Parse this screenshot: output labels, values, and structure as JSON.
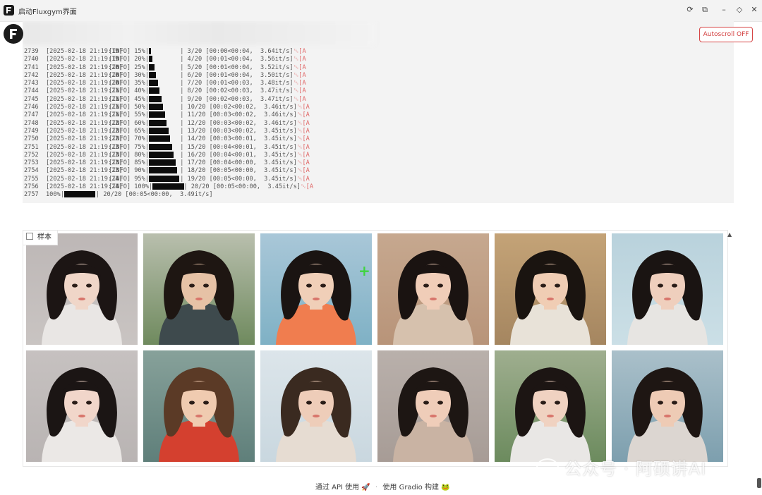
{
  "window": {
    "title": "启动Fluxgym界面",
    "controls": {
      "refresh": "⟳",
      "popout": "⧉",
      "minimize": "–",
      "restore": "◇",
      "close": "✕"
    }
  },
  "header": {
    "autoscroll_label": "Autoscroll OFF"
  },
  "log": {
    "lines": [
      {
        "num": "2739",
        "ts": "[2025-02-18 21:19:19]",
        "lvl": "[INFO] 15%|",
        "bar": 1,
        "prog": "| 3/20 [00:00<00:04,  3.64it/s]",
        "esc": "␛[A"
      },
      {
        "num": "2740",
        "ts": "[2025-02-18 21:19:19]",
        "lvl": "[INFO] 20%|",
        "bar": 2,
        "prog": "| 4/20 [00:01<00:04,  3.56it/s]",
        "esc": "␛[A"
      },
      {
        "num": "2741",
        "ts": "[2025-02-18 21:19:20]",
        "lvl": "[INFO] 25%|",
        "bar": 3,
        "prog": "| 5/20 [00:01<00:04,  3.52it/s]",
        "esc": "␛[A"
      },
      {
        "num": "2742",
        "ts": "[2025-02-18 21:19:20]",
        "lvl": "[INFO] 30%|",
        "bar": 4,
        "prog": "| 6/20 [00:01<00:04,  3.50it/s]",
        "esc": "␛[A"
      },
      {
        "num": "2743",
        "ts": "[2025-02-18 21:19:20]",
        "lvl": "[INFO] 35%|",
        "bar": 5,
        "prog": "| 7/20 [00:01<00:03,  3.48it/s]",
        "esc": "␛[A"
      },
      {
        "num": "2744",
        "ts": "[2025-02-18 21:19:21]",
        "lvl": "[INFO] 40%|",
        "bar": 6,
        "prog": "| 8/20 [00:02<00:03,  3.47it/s]",
        "esc": "␛[A"
      },
      {
        "num": "2745",
        "ts": "[2025-02-18 21:19:21]",
        "lvl": "[INFO] 45%|",
        "bar": 7,
        "prog": "| 9/20 [00:02<00:03,  3.47it/s]",
        "esc": "␛[A"
      },
      {
        "num": "2746",
        "ts": "[2025-02-18 21:19:21]",
        "lvl": "[INFO] 50%|",
        "bar": 8,
        "prog": "| 10/20 [00:02<00:02,  3.46it/s]",
        "esc": "␛[A"
      },
      {
        "num": "2747",
        "ts": "[2025-02-18 21:19:21]",
        "lvl": "[INFO] 55%|",
        "bar": 9,
        "prog": "| 11/20 [00:03<00:02,  3.46it/s]",
        "esc": "␛[A"
      },
      {
        "num": "2748",
        "ts": "[2025-02-18 21:19:22]",
        "lvl": "[INFO] 60%|",
        "bar": 10,
        "prog": "| 12/20 [00:03<00:02,  3.46it/s]",
        "esc": "␛[A"
      },
      {
        "num": "2749",
        "ts": "[2025-02-18 21:19:22]",
        "lvl": "[INFO] 65%|",
        "bar": 11,
        "prog": "| 13/20 [00:03<00:02,  3.45it/s]",
        "esc": "␛[A"
      },
      {
        "num": "2750",
        "ts": "[2025-02-18 21:19:22]",
        "lvl": "[INFO] 70%|",
        "bar": 12,
        "prog": "| 14/20 [00:03<00:01,  3.45it/s]",
        "esc": "␛[A"
      },
      {
        "num": "2751",
        "ts": "[2025-02-18 21:19:23]",
        "lvl": "[INFO] 75%|",
        "bar": 13,
        "prog": "| 15/20 [00:04<00:01,  3.45it/s]",
        "esc": "␛[A"
      },
      {
        "num": "2752",
        "ts": "[2025-02-18 21:19:23]",
        "lvl": "[INFO] 80%|",
        "bar": 14,
        "prog": "| 16/20 [00:04<00:01,  3.45it/s]",
        "esc": "␛[A"
      },
      {
        "num": "2753",
        "ts": "[2025-02-18 21:19:23]",
        "lvl": "[INFO] 85%|",
        "bar": 15,
        "prog": "| 17/20 [00:04<00:00,  3.45it/s]",
        "esc": "␛[A"
      },
      {
        "num": "2754",
        "ts": "[2025-02-18 21:19:23]",
        "lvl": "[INFO] 90%|",
        "bar": 16,
        "prog": "| 18/20 [00:05<00:00,  3.45it/s]",
        "esc": "␛[A"
      },
      {
        "num": "2755",
        "ts": "[2025-02-18 21:19:24]",
        "lvl": "[INFO] 95%|",
        "bar": 17,
        "prog": "| 19/20 [00:05<00:00,  3.45it/s]",
        "esc": "␛[A"
      },
      {
        "num": "2756",
        "ts": "[2025-02-18 21:19:24]",
        "lvl": "[INFO] 100%|",
        "bar": 18,
        "prog": "| 20/20 [00:05<00:00,  3.45it/s]",
        "esc": "␛[A"
      }
    ],
    "final_line": {
      "num": "2757",
      "pct": "100%|",
      "prog": "| 20/20 [00:05<00:00,  3.49it/s]"
    }
  },
  "gallery": {
    "label": "样本",
    "images": [
      {
        "bg": "#c9c4c2",
        "top": "#bdb7b6",
        "skin": "#f0d6c8",
        "hair": "#1c1514",
        "shirt": "#e9e6e4"
      },
      {
        "bg": "#6f8a5e",
        "top": "#b9bfae",
        "skin": "#e6c2a6",
        "hair": "#1e1612",
        "shirt": "#3e4a4d"
      },
      {
        "bg": "#7fb1c5",
        "top": "#a9c7d8",
        "skin": "#f0cfb8",
        "hair": "#1a1412",
        "shirt": "#f07d4f"
      },
      {
        "bg": "#b89479",
        "top": "#c6a88f",
        "skin": "#f0cdb8",
        "hair": "#1a1311",
        "shirt": "#d6c1ad"
      },
      {
        "bg": "#a58660",
        "top": "#c4a377",
        "skin": "#f0cdb4",
        "hair": "#1a1410",
        "shirt": "#e8e2d8"
      },
      {
        "bg": "#cbdfe6",
        "top": "#b9d2dc",
        "skin": "#efcfbd",
        "hair": "#1a1412",
        "shirt": "#e7e5e2"
      },
      {
        "bg": "#b9b4b3",
        "top": "#c6c1c0",
        "skin": "#f1d6ca",
        "hair": "#1b1514",
        "shirt": "#ebe8e6"
      },
      {
        "bg": "#5f7f7a",
        "top": "#87a19a",
        "skin": "#f0cbb0",
        "hair": "#5b3a26",
        "shirt": "#d4402f"
      },
      {
        "bg": "#c9d7df",
        "top": "#dce5ea",
        "skin": "#eecdb9",
        "hair": "#3a2a20",
        "shirt": "#e6dcd2"
      },
      {
        "bg": "#a79c96",
        "top": "#b9b0ab",
        "skin": "#efcdb9",
        "hair": "#1d1613",
        "shirt": "#c9b3a3"
      },
      {
        "bg": "#6c8b5e",
        "top": "#9fae8f",
        "skin": "#f0d2c1",
        "hair": "#1c1513",
        "shirt": "#e9e7e5"
      },
      {
        "bg": "#7d9fae",
        "top": "#aac0ca",
        "skin": "#eecbb5",
        "hair": "#1e1613",
        "shirt": "#dcd6d1"
      }
    ]
  },
  "footer": {
    "api_text": "通过 API 使用",
    "api_icon": "🚀",
    "separator": "·",
    "built_text": "使用 Gradio 构建",
    "built_icon": "🐸"
  },
  "watermark": {
    "text": "公众号 · 阿硕讲AI"
  },
  "colors": {
    "accent": "#d64545",
    "log_bg": "#f3f3f3",
    "bar": "#0d0d0d"
  }
}
